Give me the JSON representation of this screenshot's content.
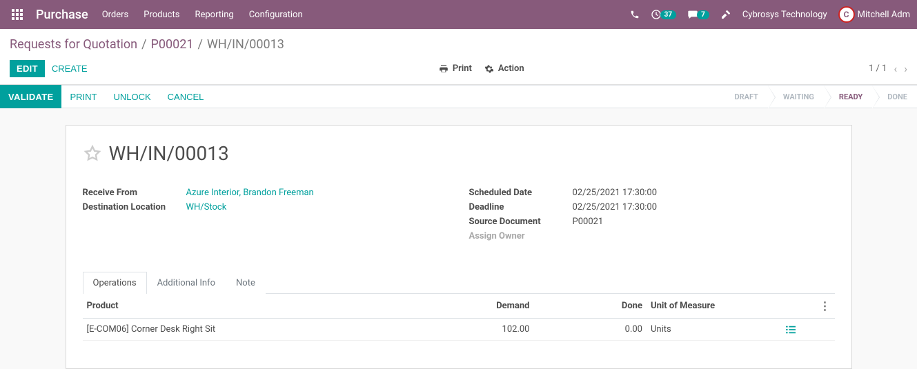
{
  "navbar": {
    "brand": "Purchase",
    "menu": [
      "Orders",
      "Products",
      "Reporting",
      "Configuration"
    ],
    "clock_badge": "37",
    "chat_badge": "7",
    "company": "Cybrosys Technology",
    "user": "Mitchell Adm",
    "avatar_letter": "C"
  },
  "breadcrumb": {
    "items": [
      "Requests for Quotation",
      "P00021"
    ],
    "current": "WH/IN/00013"
  },
  "buttons": {
    "edit": "EDIT",
    "create": "CREATE",
    "print": "Print",
    "action": "Action",
    "validate": "VALIDATE",
    "print2": "PRINT",
    "unlock": "UNLOCK",
    "cancel": "CANCEL"
  },
  "pager": {
    "text": "1 / 1"
  },
  "stages": {
    "items": [
      "DRAFT",
      "WAITING",
      "READY",
      "DONE"
    ],
    "active": "READY"
  },
  "record": {
    "name": "WH/IN/00013",
    "receive_from_label": "Receive From",
    "receive_from": "Azure Interior, Brandon Freeman",
    "destination_label": "Destination Location",
    "destination": "WH/Stock",
    "scheduled_label": "Scheduled Date",
    "scheduled": "02/25/2021 17:30:00",
    "deadline_label": "Deadline",
    "deadline": "02/25/2021 17:30:00",
    "source_label": "Source Document",
    "source": "P00021",
    "owner_label": "Assign Owner"
  },
  "tabs": {
    "items": [
      "Operations",
      "Additional Info",
      "Note"
    ]
  },
  "table": {
    "headers": {
      "product": "Product",
      "demand": "Demand",
      "done": "Done",
      "uom": "Unit of Measure"
    },
    "rows": [
      {
        "product": "[E-COM06] Corner Desk Right Sit",
        "demand": "102.00",
        "done": "0.00",
        "uom": "Units"
      }
    ]
  }
}
